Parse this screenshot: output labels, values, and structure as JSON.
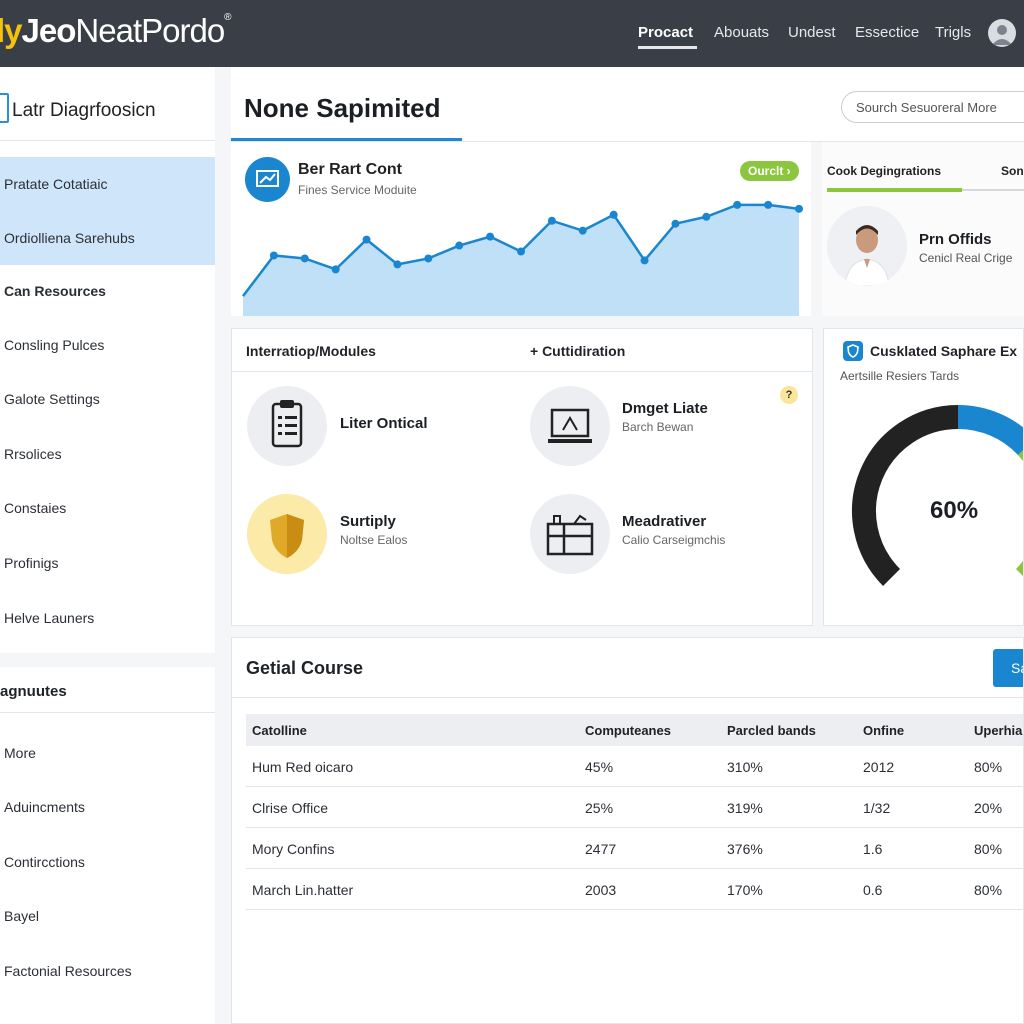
{
  "brand": {
    "part1": "ly",
    "part2": "Jeo",
    "part3": "NeatPordo",
    "reg": "®"
  },
  "nav": {
    "items": [
      {
        "label": "Procact",
        "active": true
      },
      {
        "label": "Abouats",
        "active": false
      },
      {
        "label": "Undest",
        "active": false
      },
      {
        "label": "Essectice",
        "active": false
      },
      {
        "label": "Trigls",
        "active": false
      }
    ]
  },
  "sidebar": {
    "title": "Latr Diagrfoosicn",
    "items": [
      {
        "label": "Pratate Cotatiaic",
        "selected": true
      },
      {
        "label": "Ordiolliena Sarehubs",
        "selected": true
      },
      {
        "label": "Can Resources",
        "bold": true
      },
      {
        "label": "Consling Pulces"
      },
      {
        "label": "Galote Settings"
      },
      {
        "label": "Rrsolices"
      },
      {
        "label": "Constaies"
      },
      {
        "label": "Profinigs"
      },
      {
        "label": "Helve Launers"
      }
    ],
    "section2_title": "agnuutes",
    "items2": [
      {
        "label": "More"
      },
      {
        "label": "Aduincments"
      },
      {
        "label": "Contircctions"
      },
      {
        "label": "Bayel"
      },
      {
        "label": "Factonial Resources"
      }
    ]
  },
  "header": {
    "title": "None Sapimited",
    "search_placeholder": "Sourch Sesuoreral More"
  },
  "chart_card": {
    "title": "Ber Rart Cont",
    "subtitle": "Fines Service Moduite",
    "badge": "Ourclt ›",
    "accent": "#1a86d0"
  },
  "chart_data": {
    "type": "area",
    "values": [
      20,
      61,
      58,
      47,
      77,
      52,
      58,
      71,
      80,
      65,
      96,
      86,
      102,
      56,
      93,
      100,
      112,
      112,
      108
    ],
    "x": [
      1,
      2,
      3,
      4,
      5,
      6,
      7,
      8,
      9,
      10,
      11,
      12,
      13,
      14,
      15,
      16,
      17,
      18,
      19
    ],
    "title": "",
    "xlabel": "",
    "ylabel": "",
    "fill": "#bfe0f7",
    "line": "#1a86d0"
  },
  "profile": {
    "tab1": "Cook Degingrations",
    "tab2": "Son",
    "name": "Prn Offids",
    "role": "Cenicl Real Crige"
  },
  "modules": {
    "heading1": "Interratiop/Modules",
    "heading2": "+ Cuttidiration",
    "help": "?",
    "items": [
      {
        "title": "Liter Ontical",
        "subtitle": ""
      },
      {
        "title": "Dmget Liate",
        "subtitle": "Barch Bewan"
      },
      {
        "title": "Surtiply",
        "subtitle": "Noltse Ealos"
      },
      {
        "title": "Meadrativer",
        "subtitle": "Calio Carseigmchis"
      }
    ]
  },
  "gauge": {
    "title": "Cusklated Saphare Ex",
    "subtitle": "Aertsille Resiers Tards",
    "value_label": "60%",
    "value": 0.6,
    "colors": {
      "dark": "#222222",
      "blue": "#1a86d0",
      "green": "#8cc63f"
    }
  },
  "course": {
    "title": "Getial Course",
    "button": "Sa",
    "columns": [
      "Catolline",
      "Computeanes",
      "Parcled bands",
      "Onfine",
      "Uperhia"
    ],
    "rows": [
      [
        "Hum Red oicaro",
        "45%",
        "310%",
        "2012",
        "80%"
      ],
      [
        "Clrise Office",
        "25%",
        "319%",
        "1/32",
        "20%"
      ],
      [
        "Mory Confins",
        "2477",
        "376%",
        "1.6",
        "80%"
      ],
      [
        "March Lin.hatter",
        "2003",
        "170%",
        "0.6",
        "80%"
      ]
    ]
  }
}
